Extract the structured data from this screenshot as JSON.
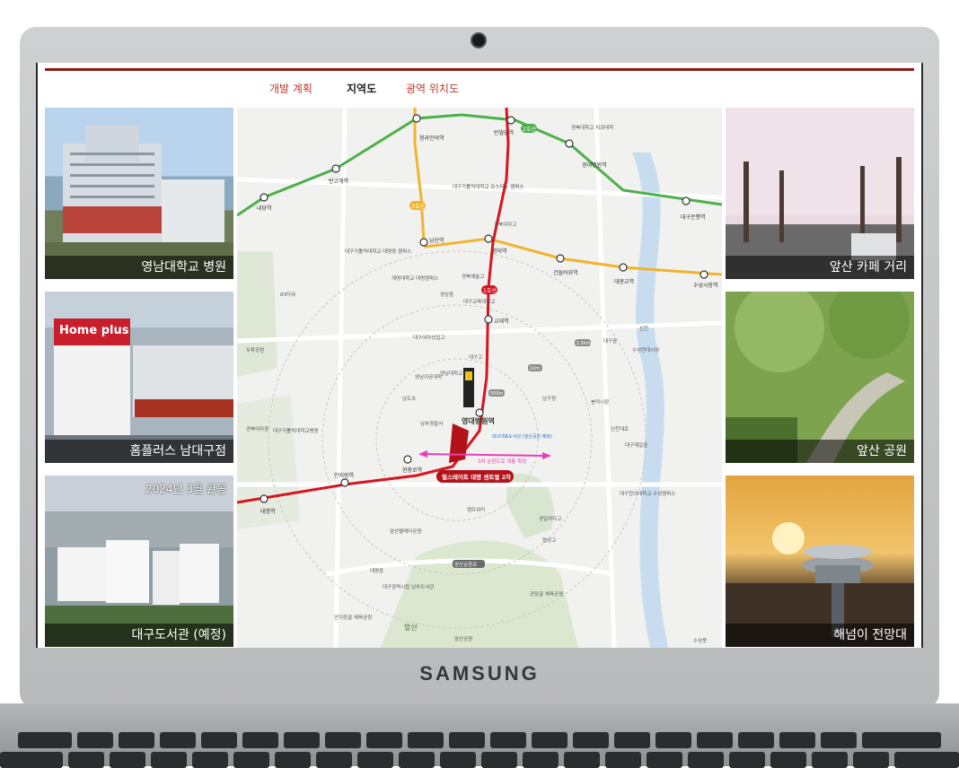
{
  "device": {
    "brand": "SAMSUNG"
  },
  "tabs": [
    {
      "label": "개발 계획",
      "active": false
    },
    {
      "label": "지역도",
      "active": true
    },
    {
      "label": "광역 위치도",
      "active": false
    }
  ],
  "left_tiles": [
    {
      "caption": "영남대학교 병원"
    },
    {
      "caption": "홈플러스 남대구점",
      "sign": "Home plus"
    },
    {
      "caption": "대구도서관 (예정)",
      "note": "2024년 3월 완공"
    }
  ],
  "right_tiles": [
    {
      "caption": "앞산 카페 거리"
    },
    {
      "caption": "앞산 공원"
    },
    {
      "caption": "해넘이 전망대"
    }
  ],
  "map": {
    "stations": [
      "반고개역",
      "청라언덕역",
      "반월당역",
      "경대병원역",
      "대구은행역",
      "내당역",
      "남산역",
      "명덕역",
      "건들바위역",
      "대봉교역",
      "수성시장역",
      "교대역",
      "영대병원역",
      "현충로역",
      "안지랑역",
      "대명역"
    ],
    "line_labels": [
      "2호선",
      "3호선",
      "1호선"
    ],
    "places": [
      "경북대학교 치과대학",
      "대구가톨릭대학교 유스티노 캠퍼스",
      "경북여자고",
      "대구가톨릭대학교 대명동 캠퍼스",
      "83타워",
      "계명대학교 대명캠퍼스",
      "경북예술고",
      "경상중",
      "대구교육대학교",
      "대구여자상업고",
      "대구고",
      "영남대학교 병원",
      "영남이공대학",
      "남도초",
      "대구중",
      "수성현대시장",
      "남구청",
      "봉덕시장",
      "남부경찰서",
      "경북여자중",
      "대구가톨릭대학교병원",
      "신천대로",
      "대구제일중",
      "대구한의대학교 수성캠퍼스",
      "캠프워커",
      "앞산빨래터공원",
      "경일여자고",
      "협성고",
      "대명중",
      "대구광역시립 남부도서관",
      "앞산순환로",
      "안지랑골 체육공원",
      "강당골 체육공원",
      "앞산",
      "앞산공원",
      "수성못",
      "두류공원",
      "신천"
    ],
    "distances": [
      "500m",
      "1km",
      "1.5km"
    ],
    "highlight": "힐스테이트 대명 센트럴 2차",
    "arrow_label": "3차 순환도로 개통 확정",
    "library_label": "대구대표도서관 (앞산공원 예정)",
    "road_label": "앞산순환로"
  },
  "colors": {
    "accent": "#8b1a1a",
    "line1": "#d7141f",
    "line2": "#4cb04a",
    "line3": "#f0b430",
    "arrow": "#e83fb5",
    "highlight_fill": "#b3121a"
  }
}
